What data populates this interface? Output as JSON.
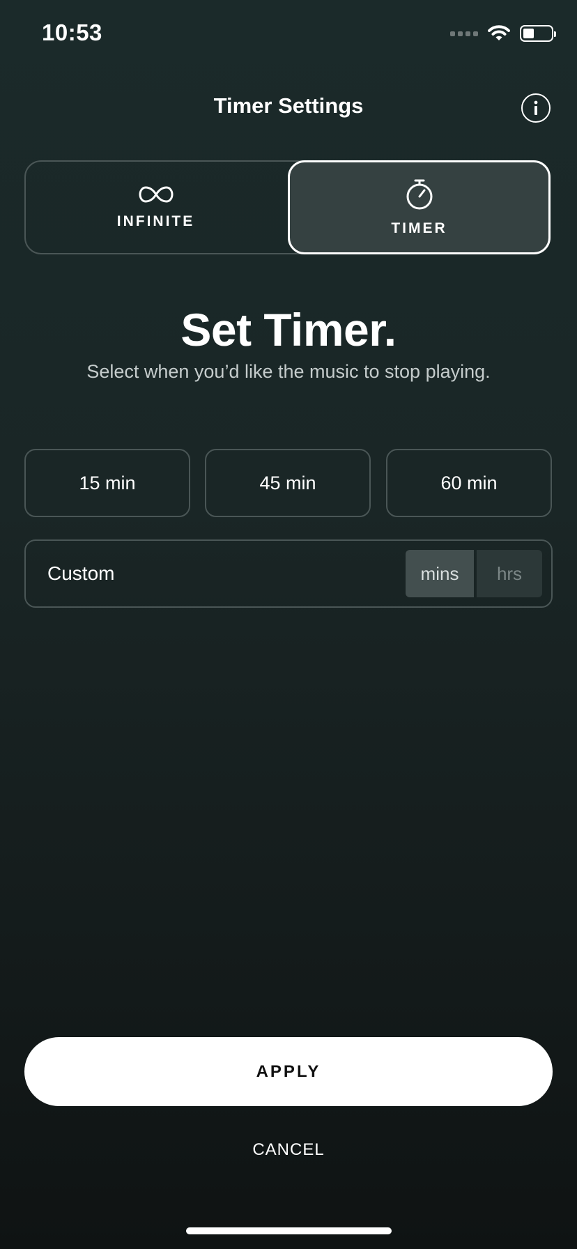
{
  "status_bar": {
    "time": "10:53",
    "icons": [
      "cellular-signal-icon",
      "wifi-icon",
      "battery-icon"
    ],
    "battery_level": 0.4
  },
  "header": {
    "title": "Timer Settings",
    "info_icon": "info-icon"
  },
  "mode_toggle": {
    "options": [
      {
        "label": "INFINITE",
        "icon": "infinity-icon",
        "selected": false
      },
      {
        "label": "TIMER",
        "icon": "stopwatch-icon",
        "selected": true
      }
    ]
  },
  "main": {
    "headline": "Set Timer.",
    "subtitle": "Select when you’d like the music to stop playing."
  },
  "presets": [
    {
      "label": "15 min"
    },
    {
      "label": "45 min"
    },
    {
      "label": "60 min"
    }
  ],
  "custom": {
    "label": "Custom",
    "units": [
      {
        "label": "mins",
        "selected": true
      },
      {
        "label": "hrs",
        "selected": false
      }
    ]
  },
  "actions": {
    "apply_label": "APPLY",
    "cancel_label": "CANCEL"
  },
  "colors": {
    "background_top": "#1b2a2a",
    "background_bottom": "#0f1313",
    "selected_mode_bg": "#354141",
    "border": "#4a5656",
    "apply_bg": "#ffffff",
    "apply_text": "#111111"
  }
}
